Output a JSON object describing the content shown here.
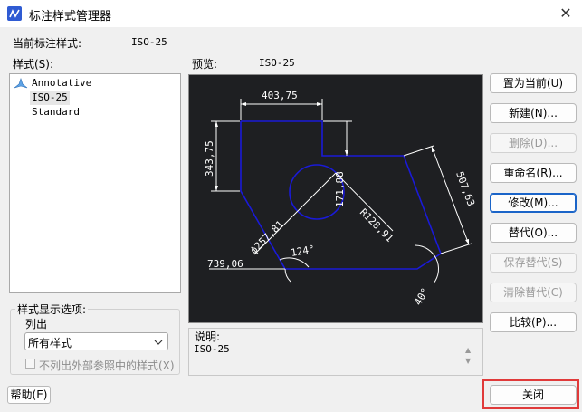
{
  "window": {
    "title": "标注样式管理器",
    "close_glyph": "✕"
  },
  "current_style": {
    "label": "当前标注样式:",
    "value": "ISO-25"
  },
  "styles_section": {
    "label": "样式(S):",
    "items": [
      {
        "name": "Annotative",
        "icon": "annotative-scale-icon"
      },
      {
        "name": "ISO-25",
        "selected": true
      },
      {
        "name": "Standard"
      }
    ]
  },
  "preview_section": {
    "label": "预览:",
    "value": "ISO-25"
  },
  "preview_drawing": {
    "dim_top": "403,75",
    "dim_left": "343,75",
    "dim_mid": "171,88",
    "dim_diam": "ϕ257,81",
    "dim_radius": "R128,91",
    "dim_right": "507,63",
    "dim_angle1": "124°",
    "dim_baseline": "739,06",
    "dim_angle2": "40°"
  },
  "buttons": {
    "set_current": "置为当前(U)",
    "new": "新建(N)...",
    "delete": "删除(D)...",
    "rename": "重命名(R)...",
    "modify": "修改(M)...",
    "override": "替代(O)...",
    "save_override": "保存替代(S)",
    "clear_override": "清除替代(C)",
    "compare": "比较(P)...",
    "help": "帮助(E)",
    "close": "关闭"
  },
  "display_options": {
    "group_label": "样式显示选项:",
    "list_label": "列出",
    "select_value": "所有样式",
    "checkbox_label": "不列出外部参照中的样式(X)",
    "checkbox_checked": false
  },
  "description": {
    "label": "说明:",
    "value": "ISO-25"
  },
  "colors": {
    "preview_bg": "#1e1f22",
    "geometry": "#1a1ad8",
    "dim_lines": "#ffffff",
    "close_highlight": "#e03a3a"
  }
}
